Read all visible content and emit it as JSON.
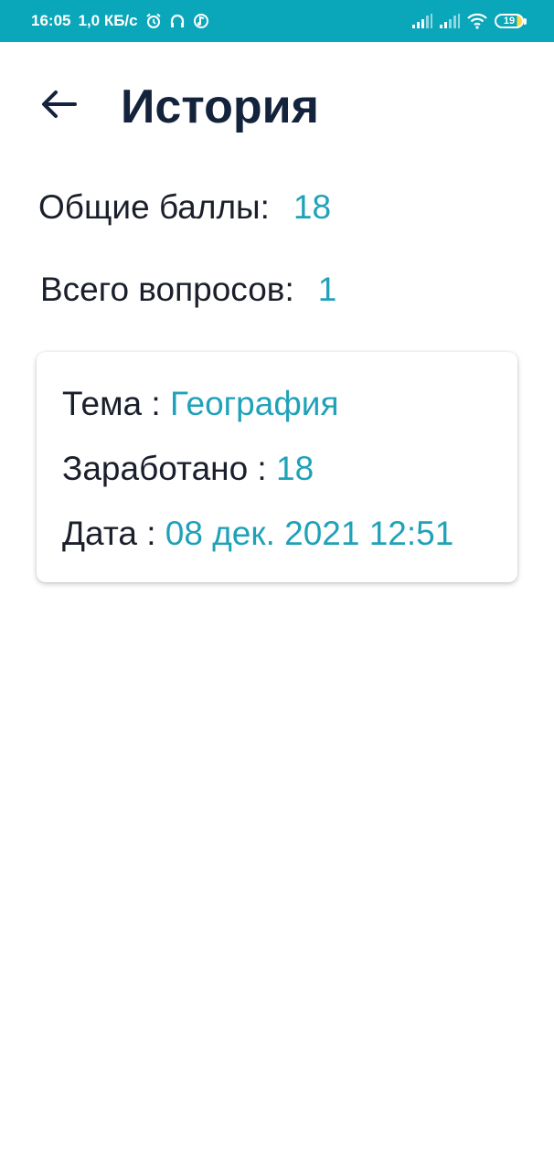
{
  "status_bar": {
    "time": "16:05",
    "speed": "1,0 КБ/с",
    "battery_level": "19",
    "icons": [
      "alarm-icon",
      "headphones-icon",
      "music-app-icon",
      "signal-icon",
      "signal-icon",
      "wifi-icon",
      "battery-icon"
    ]
  },
  "header": {
    "back_icon": "arrow-left-icon",
    "title": "История"
  },
  "summary": {
    "total_points_label": "Общие баллы:",
    "total_points_value": "18",
    "total_questions_label": "Всего вопросов:",
    "total_questions_value": "1"
  },
  "history": [
    {
      "topic_label": "Тема : ",
      "topic": "География",
      "earned_label": "Заработано : ",
      "earned": "18",
      "date_label": "Дата : ",
      "date": "08 дек. 2021 12:51"
    }
  ],
  "colors": {
    "status_bar": "#0aa6b9",
    "accent": "#1fa2b8",
    "title": "#14233c",
    "text": "#1a1f2b"
  }
}
